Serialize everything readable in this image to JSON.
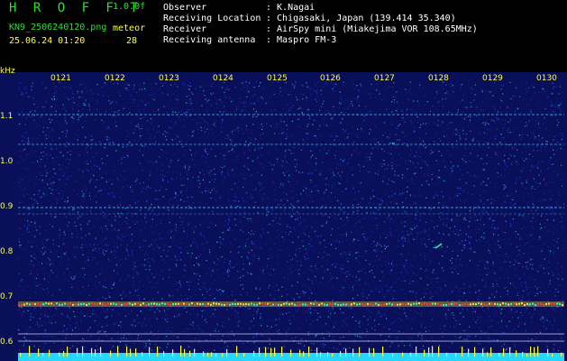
{
  "header": {
    "app_name": "H R O F F T",
    "version": "1.0.0f",
    "filename": "KN9_2506240120.png",
    "label_meteor": "meteor",
    "timestamp": "25.06.24 01:20",
    "count": "28"
  },
  "station": {
    "observer_label": "Observer",
    "observer_value": ": K.Nagai",
    "location_label": "Receiving Location",
    "location_value": ": Chigasaki, Japan (139.414 35.340)",
    "receiver_label": "Receiver",
    "receiver_value": ": AirSpy mini (Miakejima VOR 108.65MHz)",
    "antenna_label": "Receiving antenna",
    "antenna_value": ": Maspro FM-3"
  },
  "spectrogram": {
    "y_unit": "kHz",
    "y_ticks": [
      "1.1",
      "1.0",
      "0.9",
      "0.8",
      "0.7",
      "0.6"
    ],
    "x_ticks": [
      "0121",
      "0122",
      "0123",
      "0124",
      "0125",
      "0126",
      "0127",
      "0128",
      "0129",
      "0130"
    ],
    "background_color": "#0a0f5a",
    "carrier_colors": [
      "#ff4020",
      "#ffe030",
      "#30ffb0"
    ],
    "line_color": "#4ad0ff"
  }
}
